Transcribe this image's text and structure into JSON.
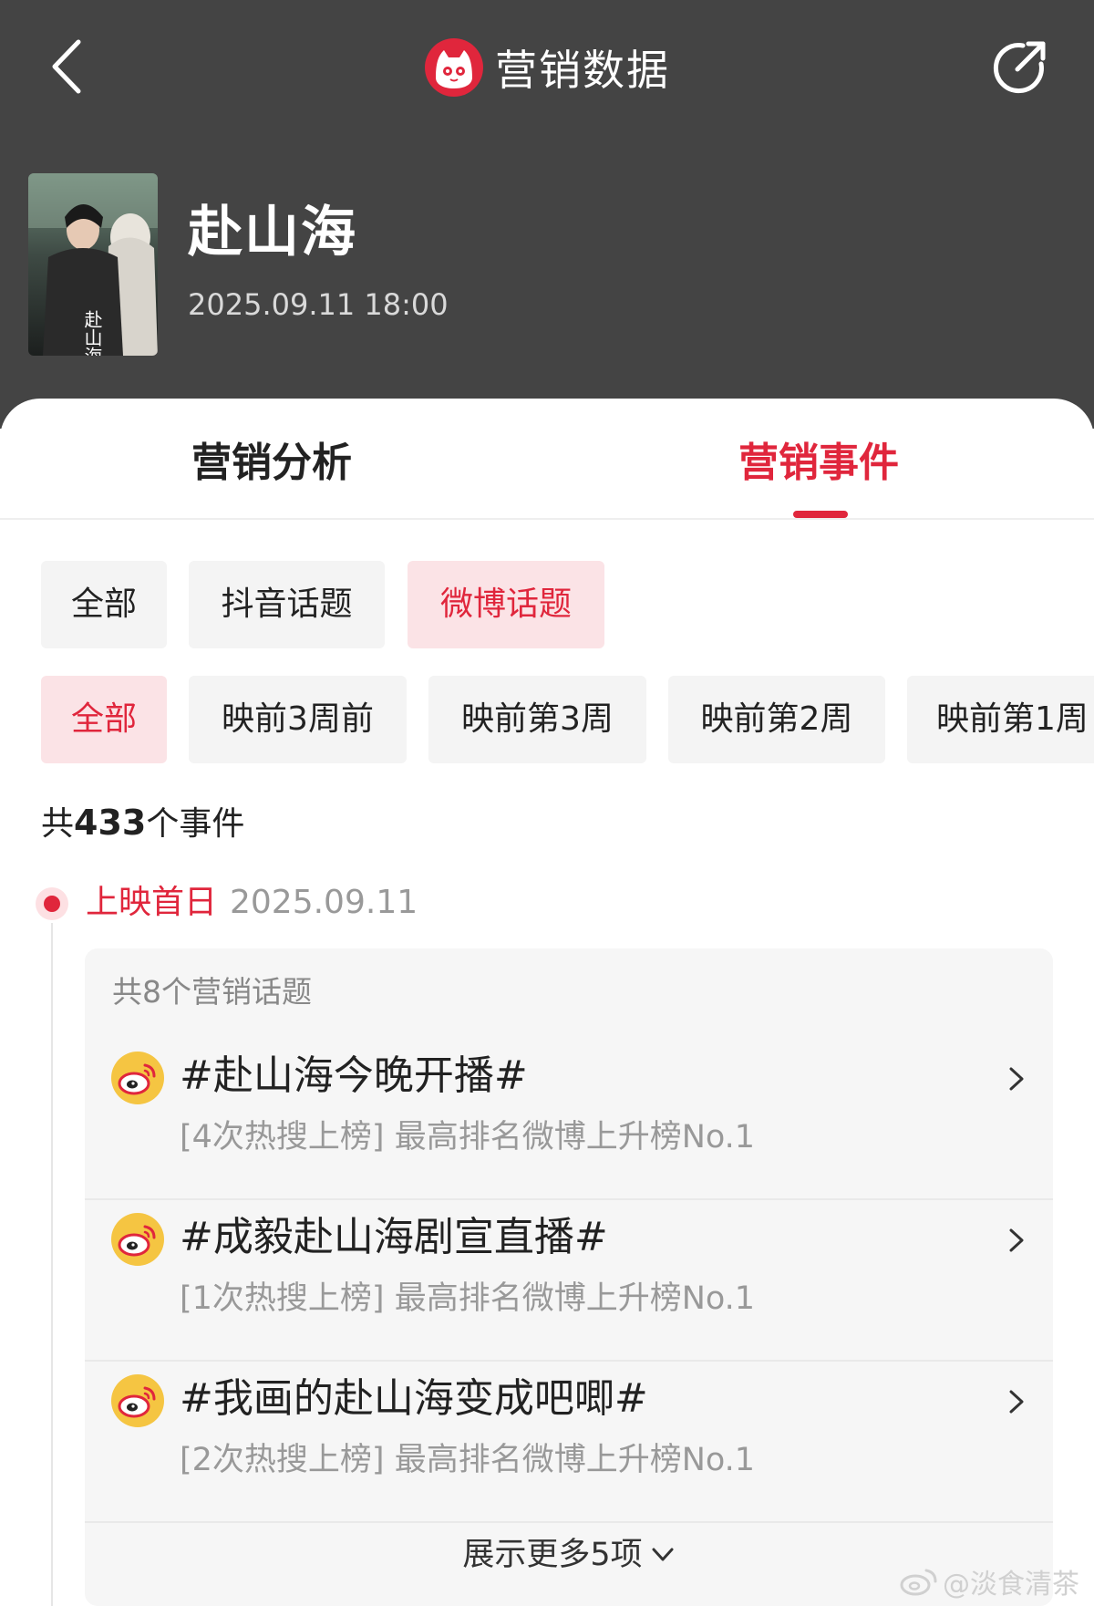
{
  "nav": {
    "title": "营销数据",
    "back_icon": "chevron-left-icon",
    "share_icon": "share-icon",
    "logo_icon": "cat-logo-icon"
  },
  "movie": {
    "title": "赴山海",
    "datetime": "2025.09.11 18:00",
    "poster_text": "赴山海"
  },
  "tabs": [
    {
      "label": "营销分析",
      "active": false
    },
    {
      "label": "营销事件",
      "active": true
    }
  ],
  "platform_filters": [
    {
      "label": "全部",
      "active": false
    },
    {
      "label": "抖音话题",
      "active": false
    },
    {
      "label": "微博话题",
      "active": true
    }
  ],
  "period_filters": [
    {
      "label": "全部",
      "active": true
    },
    {
      "label": "映前3周前",
      "active": false
    },
    {
      "label": "映前第3周",
      "active": false
    },
    {
      "label": "映前第2周",
      "active": false
    },
    {
      "label": "映前第1周",
      "active": false
    }
  ],
  "summary": {
    "prefix": "共",
    "count": "433",
    "suffix": "个事件"
  },
  "timeline": {
    "label": "上映首日",
    "date": "2025.09.11",
    "card": {
      "count_text": "共8个营销话题",
      "topics": [
        {
          "title": "#赴山海今晚开播#",
          "sub": "[4次热搜上榜] 最高排名微博上升榜No.1"
        },
        {
          "title": "#成毅赴山海剧宣直播#",
          "sub": "[1次热搜上榜] 最高排名微博上升榜No.1"
        },
        {
          "title": "#我画的赴山海变成吧唧#",
          "sub": "[2次热搜上榜] 最高排名微博上升榜No.1"
        }
      ],
      "show_more": "展示更多5项"
    }
  },
  "watermark": "@淡食清茶",
  "colors": {
    "accent": "#e0263c",
    "header_bg": "#444444",
    "chip_bg": "#f4f4f4",
    "chip_active_bg": "#fbe3e6",
    "card_bg": "#f6f6f6"
  }
}
